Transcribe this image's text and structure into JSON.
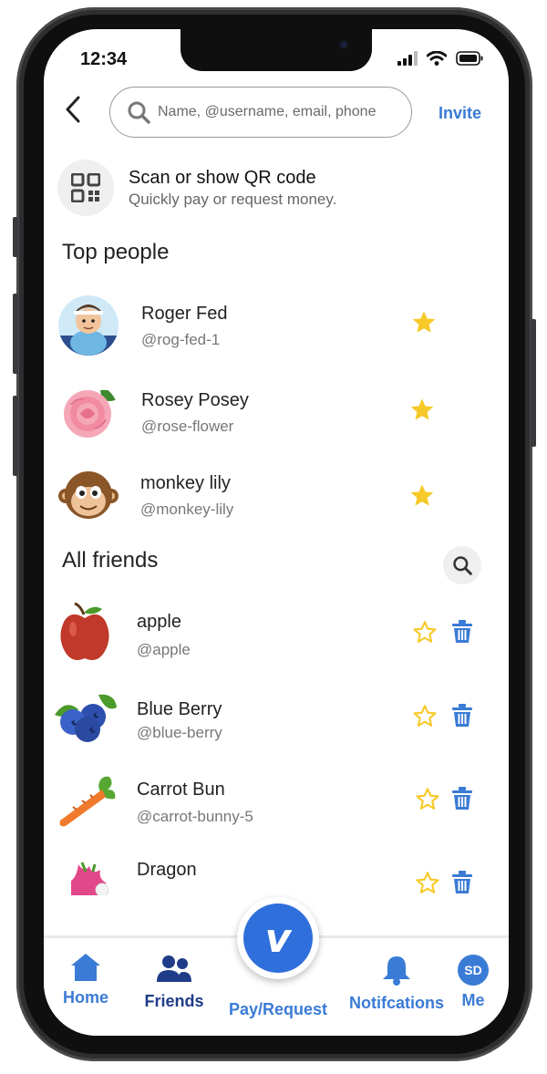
{
  "status": {
    "time": "12:34"
  },
  "search": {
    "placeholder": "Name, @username, email, phone",
    "value": ""
  },
  "invite_label": "Invite",
  "qr": {
    "title": "Scan or show QR code",
    "subtitle": "Quickly pay or request money."
  },
  "top_people": {
    "title": "Top people",
    "items": [
      {
        "name": "Roger Fed",
        "handle": "@rog-fed-1",
        "favorite": true
      },
      {
        "name": "Rosey Posey",
        "handle": "@rose-flower",
        "favorite": true
      },
      {
        "name": "monkey lily",
        "handle": "@monkey-lily",
        "favorite": true
      }
    ]
  },
  "all_friends": {
    "title": "All friends",
    "items": [
      {
        "name": "apple",
        "handle": "@apple",
        "favorite": false
      },
      {
        "name": "Blue Berry",
        "handle": "@blue-berry",
        "favorite": false
      },
      {
        "name": "Carrot Bun",
        "handle": "@carrot-bunny-5",
        "favorite": false
      },
      {
        "name": "Dragon",
        "handle": "",
        "favorite": false
      }
    ]
  },
  "tabs": {
    "home": "Home",
    "friends": "Friends",
    "pay": "Pay/Request",
    "notifications": "Notifcations",
    "me": "Me",
    "me_initials": "SD",
    "fab_letter": "v"
  },
  "colors": {
    "accent": "#3a7bd5",
    "star": "#f7c928"
  }
}
